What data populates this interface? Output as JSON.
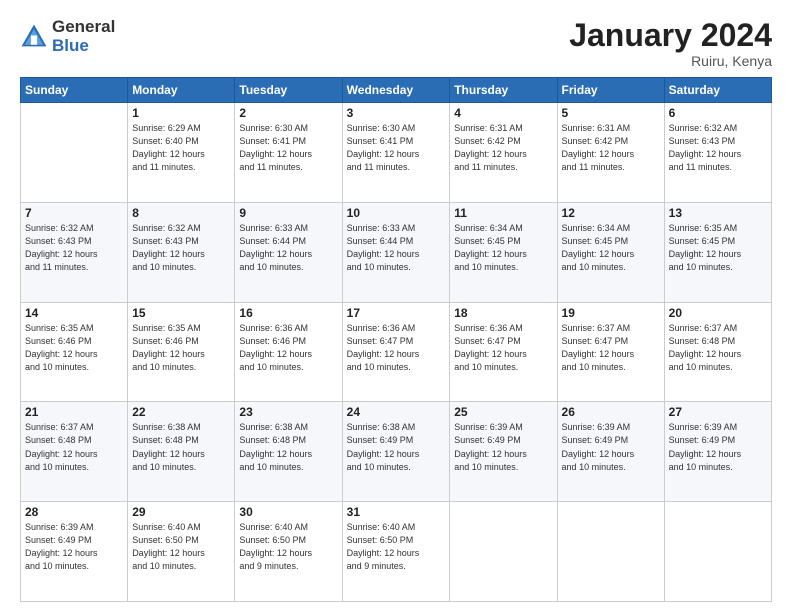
{
  "logo": {
    "general": "General",
    "blue": "Blue"
  },
  "title": "January 2024",
  "location": "Ruiru, Kenya",
  "days_header": [
    "Sunday",
    "Monday",
    "Tuesday",
    "Wednesday",
    "Thursday",
    "Friday",
    "Saturday"
  ],
  "weeks": [
    [
      {
        "day": "",
        "info": ""
      },
      {
        "day": "1",
        "info": "Sunrise: 6:29 AM\nSunset: 6:40 PM\nDaylight: 12 hours\nand 11 minutes."
      },
      {
        "day": "2",
        "info": "Sunrise: 6:30 AM\nSunset: 6:41 PM\nDaylight: 12 hours\nand 11 minutes."
      },
      {
        "day": "3",
        "info": "Sunrise: 6:30 AM\nSunset: 6:41 PM\nDaylight: 12 hours\nand 11 minutes."
      },
      {
        "day": "4",
        "info": "Sunrise: 6:31 AM\nSunset: 6:42 PM\nDaylight: 12 hours\nand 11 minutes."
      },
      {
        "day": "5",
        "info": "Sunrise: 6:31 AM\nSunset: 6:42 PM\nDaylight: 12 hours\nand 11 minutes."
      },
      {
        "day": "6",
        "info": "Sunrise: 6:32 AM\nSunset: 6:43 PM\nDaylight: 12 hours\nand 11 minutes."
      }
    ],
    [
      {
        "day": "7",
        "info": "Sunrise: 6:32 AM\nSunset: 6:43 PM\nDaylight: 12 hours\nand 11 minutes."
      },
      {
        "day": "8",
        "info": "Sunrise: 6:32 AM\nSunset: 6:43 PM\nDaylight: 12 hours\nand 10 minutes."
      },
      {
        "day": "9",
        "info": "Sunrise: 6:33 AM\nSunset: 6:44 PM\nDaylight: 12 hours\nand 10 minutes."
      },
      {
        "day": "10",
        "info": "Sunrise: 6:33 AM\nSunset: 6:44 PM\nDaylight: 12 hours\nand 10 minutes."
      },
      {
        "day": "11",
        "info": "Sunrise: 6:34 AM\nSunset: 6:45 PM\nDaylight: 12 hours\nand 10 minutes."
      },
      {
        "day": "12",
        "info": "Sunrise: 6:34 AM\nSunset: 6:45 PM\nDaylight: 12 hours\nand 10 minutes."
      },
      {
        "day": "13",
        "info": "Sunrise: 6:35 AM\nSunset: 6:45 PM\nDaylight: 12 hours\nand 10 minutes."
      }
    ],
    [
      {
        "day": "14",
        "info": "Sunrise: 6:35 AM\nSunset: 6:46 PM\nDaylight: 12 hours\nand 10 minutes."
      },
      {
        "day": "15",
        "info": "Sunrise: 6:35 AM\nSunset: 6:46 PM\nDaylight: 12 hours\nand 10 minutes."
      },
      {
        "day": "16",
        "info": "Sunrise: 6:36 AM\nSunset: 6:46 PM\nDaylight: 12 hours\nand 10 minutes."
      },
      {
        "day": "17",
        "info": "Sunrise: 6:36 AM\nSunset: 6:47 PM\nDaylight: 12 hours\nand 10 minutes."
      },
      {
        "day": "18",
        "info": "Sunrise: 6:36 AM\nSunset: 6:47 PM\nDaylight: 12 hours\nand 10 minutes."
      },
      {
        "day": "19",
        "info": "Sunrise: 6:37 AM\nSunset: 6:47 PM\nDaylight: 12 hours\nand 10 minutes."
      },
      {
        "day": "20",
        "info": "Sunrise: 6:37 AM\nSunset: 6:48 PM\nDaylight: 12 hours\nand 10 minutes."
      }
    ],
    [
      {
        "day": "21",
        "info": "Sunrise: 6:37 AM\nSunset: 6:48 PM\nDaylight: 12 hours\nand 10 minutes."
      },
      {
        "day": "22",
        "info": "Sunrise: 6:38 AM\nSunset: 6:48 PM\nDaylight: 12 hours\nand 10 minutes."
      },
      {
        "day": "23",
        "info": "Sunrise: 6:38 AM\nSunset: 6:48 PM\nDaylight: 12 hours\nand 10 minutes."
      },
      {
        "day": "24",
        "info": "Sunrise: 6:38 AM\nSunset: 6:49 PM\nDaylight: 12 hours\nand 10 minutes."
      },
      {
        "day": "25",
        "info": "Sunrise: 6:39 AM\nSunset: 6:49 PM\nDaylight: 12 hours\nand 10 minutes."
      },
      {
        "day": "26",
        "info": "Sunrise: 6:39 AM\nSunset: 6:49 PM\nDaylight: 12 hours\nand 10 minutes."
      },
      {
        "day": "27",
        "info": "Sunrise: 6:39 AM\nSunset: 6:49 PM\nDaylight: 12 hours\nand 10 minutes."
      }
    ],
    [
      {
        "day": "28",
        "info": "Sunrise: 6:39 AM\nSunset: 6:49 PM\nDaylight: 12 hours\nand 10 minutes."
      },
      {
        "day": "29",
        "info": "Sunrise: 6:40 AM\nSunset: 6:50 PM\nDaylight: 12 hours\nand 10 minutes."
      },
      {
        "day": "30",
        "info": "Sunrise: 6:40 AM\nSunset: 6:50 PM\nDaylight: 12 hours\nand 9 minutes."
      },
      {
        "day": "31",
        "info": "Sunrise: 6:40 AM\nSunset: 6:50 PM\nDaylight: 12 hours\nand 9 minutes."
      },
      {
        "day": "",
        "info": ""
      },
      {
        "day": "",
        "info": ""
      },
      {
        "day": "",
        "info": ""
      }
    ]
  ]
}
